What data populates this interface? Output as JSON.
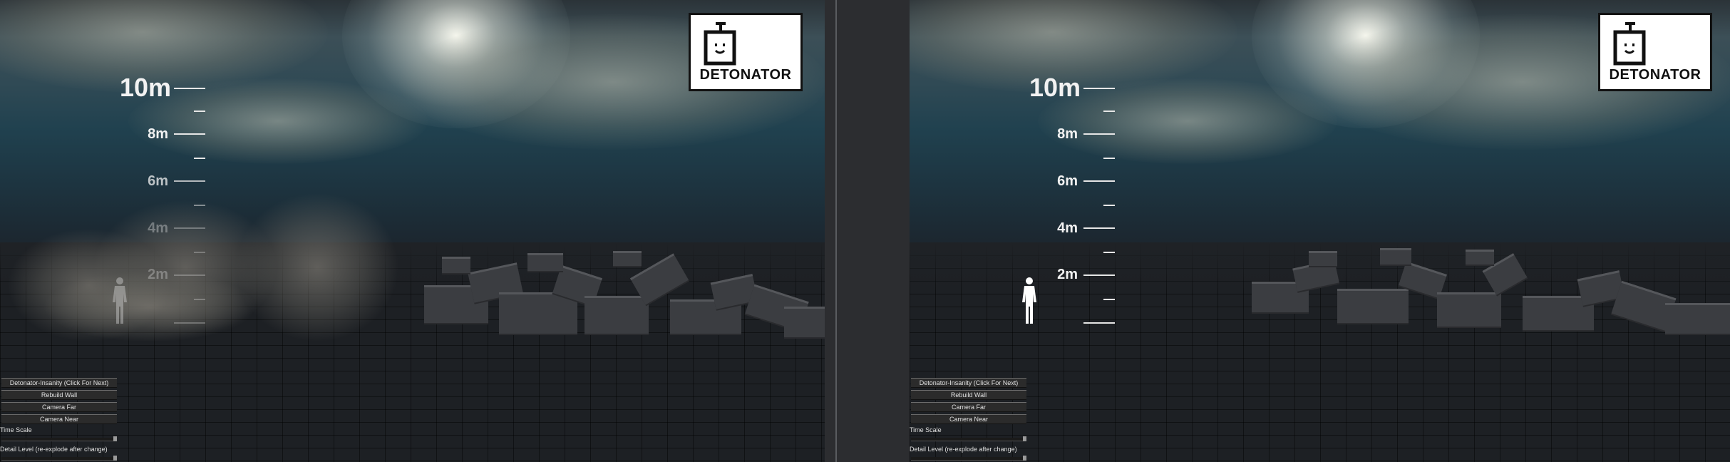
{
  "viewports": [
    {
      "id": "left",
      "logo_text": "DETONATOR",
      "ruler": [
        {
          "label": "10m",
          "major": true
        },
        {
          "label": "8m",
          "major": true
        },
        {
          "label": "6m",
          "major": true
        },
        {
          "label": "4m",
          "major": true
        },
        {
          "label": "2m",
          "major": true
        }
      ],
      "controls": {
        "buttons": [
          "Detonator-Insanity (Click For Next)",
          "Rebuild Wall",
          "Camera Far",
          "Camera Near"
        ],
        "time_scale_label": "Time Scale",
        "time_scale_value": 1.0,
        "detail_level_label": "Detail Level (re-explode after change)",
        "detail_level_value": 1.0
      }
    },
    {
      "id": "right",
      "logo_text": "DETONATOR",
      "ruler": [
        {
          "label": "10m",
          "major": true
        },
        {
          "label": "8m",
          "major": true
        },
        {
          "label": "6m",
          "major": true
        },
        {
          "label": "4m",
          "major": true
        },
        {
          "label": "2m",
          "major": true
        }
      ],
      "controls": {
        "buttons": [
          "Detonator-Insanity (Click For Next)",
          "Rebuild Wall",
          "Camera Far",
          "Camera Near"
        ],
        "time_scale_label": "Time Scale",
        "time_scale_value": 1.0,
        "detail_level_label": "Detail Level (re-explode after change)",
        "detail_level_value": 1.0
      }
    }
  ]
}
